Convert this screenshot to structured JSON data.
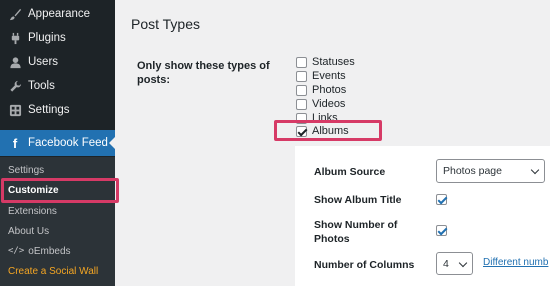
{
  "sidebar": {
    "menu": [
      {
        "label": "Appearance",
        "icon": "paintbrush-icon"
      },
      {
        "label": "Plugins",
        "icon": "plug-icon"
      },
      {
        "label": "Users",
        "icon": "user-icon"
      },
      {
        "label": "Tools",
        "icon": "wrench-icon"
      },
      {
        "label": "Settings",
        "icon": "settings-icon"
      }
    ],
    "active": {
      "label": "Facebook Feed",
      "icon": "facebook-icon"
    },
    "submenu": [
      {
        "label": "Settings"
      },
      {
        "label": "Customize"
      },
      {
        "label": "Extensions"
      },
      {
        "label": "About Us"
      },
      {
        "label": "oEmbeds",
        "prefix": "</>"
      },
      {
        "label": "Create a Social Wall"
      }
    ]
  },
  "main": {
    "section_title": "Post Types",
    "field_label": "Only show these types of posts:",
    "post_types": [
      {
        "label": "Statuses",
        "checked": false
      },
      {
        "label": "Events",
        "checked": false
      },
      {
        "label": "Photos",
        "checked": false
      },
      {
        "label": "Videos",
        "checked": false
      },
      {
        "label": "Links",
        "checked": false
      },
      {
        "label": "Albums",
        "checked": true
      }
    ]
  },
  "album_panel": {
    "source_label": "Album Source",
    "source_value": "Photos page",
    "show_title_label": "Show Album Title",
    "show_title_checked": true,
    "show_number_label": "Show Number of Photos",
    "show_number_checked": true,
    "columns_label": "Number of Columns",
    "columns_value": "4",
    "different_link": "Different numb"
  },
  "colors": {
    "sidebar_bg": "#1d2327",
    "active_bg": "#2271b1",
    "highlight": "#d63a66",
    "link": "#2271b1",
    "orange": "#f5a623"
  }
}
